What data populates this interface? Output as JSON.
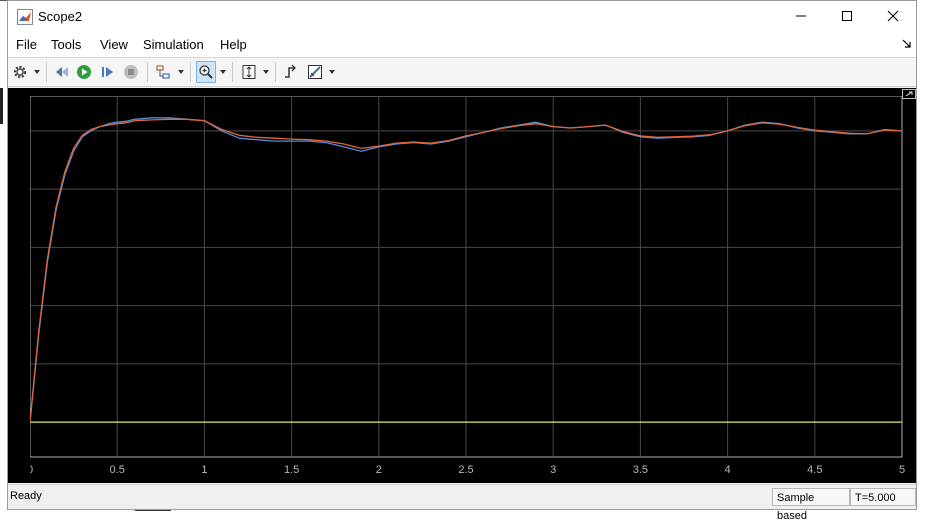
{
  "window": {
    "title": "Scope2"
  },
  "menu": {
    "items": [
      "File",
      "Tools",
      "View",
      "Simulation",
      "Help"
    ]
  },
  "toolbar": {
    "buttons": [
      "settings-icon",
      "step-back-icon",
      "run-icon",
      "step-forward-icon",
      "stop-icon",
      "signal-selector-icon",
      "zoom-in-icon",
      "scale-axes-icon",
      "triggers-icon",
      "measurements-icon"
    ]
  },
  "status": {
    "text": "Ready",
    "mode": "Sample based",
    "time": "T=5.000"
  },
  "colors": {
    "background": "#000000",
    "grid": "#4a4a4a",
    "axis_text": "#b8b8b8",
    "series_blue": "#4a8fd8",
    "series_orange": "#e0663a",
    "series_yellow": "#e8e352"
  },
  "chart_data": {
    "type": "line",
    "xlim": [
      0,
      5
    ],
    "ylim": [
      -0.12,
      1.12
    ],
    "xticks": [
      "0",
      "0.5",
      "1",
      "1.5",
      "2",
      "2.5",
      "3",
      "3.5",
      "4",
      "4.5",
      "5"
    ],
    "yticks": [
      "0",
      "0.2",
      "0.4",
      "0.6",
      "0.8",
      "1"
    ],
    "grid": true,
    "series": [
      {
        "color": "#4a8fd8",
        "x": [
          0,
          0.05,
          0.1,
          0.15,
          0.2,
          0.25,
          0.3,
          0.35,
          0.4,
          0.45,
          0.5,
          0.55,
          0.6,
          0.7,
          0.8,
          0.9,
          1.0,
          1.1,
          1.2,
          1.3,
          1.4,
          1.5,
          1.6,
          1.7,
          1.8,
          1.9,
          2.0,
          2.1,
          2.2,
          2.3,
          2.4,
          2.5,
          2.6,
          2.7,
          2.8,
          2.9,
          3.0,
          3.1,
          3.2,
          3.3,
          3.4,
          3.5,
          3.6,
          3.7,
          3.8,
          3.9,
          4.0,
          4.1,
          4.2,
          4.3,
          4.4,
          4.5,
          4.6,
          4.7,
          4.8,
          4.9,
          5.0
        ],
        "y": [
          0,
          0.3,
          0.55,
          0.73,
          0.85,
          0.93,
          0.98,
          1.0,
          1.015,
          1.025,
          1.03,
          1.033,
          1.04,
          1.045,
          1.045,
          1.04,
          1.035,
          1.0,
          0.975,
          0.97,
          0.965,
          0.965,
          0.965,
          0.96,
          0.945,
          0.93,
          0.945,
          0.955,
          0.96,
          0.955,
          0.965,
          0.98,
          0.995,
          1.01,
          1.02,
          1.03,
          1.015,
          1.01,
          1.015,
          1.02,
          0.995,
          0.98,
          0.975,
          0.978,
          0.98,
          0.985,
          1.0,
          1.02,
          1.03,
          1.025,
          1.01,
          1.0,
          0.995,
          0.99,
          0.99,
          1.005,
          1.0
        ]
      },
      {
        "color": "#e0663a",
        "x": [
          0,
          0.05,
          0.1,
          0.15,
          0.2,
          0.25,
          0.3,
          0.35,
          0.4,
          0.45,
          0.5,
          0.55,
          0.6,
          0.7,
          0.8,
          0.9,
          1.0,
          1.1,
          1.2,
          1.3,
          1.4,
          1.5,
          1.6,
          1.7,
          1.8,
          1.9,
          2.0,
          2.1,
          2.2,
          2.3,
          2.4,
          2.5,
          2.6,
          2.7,
          2.8,
          2.9,
          3.0,
          3.1,
          3.2,
          3.3,
          3.4,
          3.5,
          3.6,
          3.7,
          3.8,
          3.9,
          4.0,
          4.1,
          4.2,
          4.3,
          4.4,
          4.5,
          4.6,
          4.7,
          4.8,
          4.9,
          5.0
        ],
        "y": [
          0,
          0.31,
          0.56,
          0.74,
          0.86,
          0.94,
          0.985,
          1.005,
          1.015,
          1.02,
          1.025,
          1.028,
          1.035,
          1.038,
          1.04,
          1.04,
          1.035,
          1.005,
          0.985,
          0.978,
          0.975,
          0.972,
          0.97,
          0.965,
          0.955,
          0.94,
          0.948,
          0.958,
          0.962,
          0.958,
          0.967,
          0.983,
          0.995,
          1.008,
          1.018,
          1.025,
          1.015,
          1.01,
          1.015,
          1.02,
          0.998,
          0.983,
          0.978,
          0.98,
          0.982,
          0.987,
          1.0,
          1.018,
          1.028,
          1.023,
          1.012,
          1.003,
          0.997,
          0.992,
          0.99,
          1.003,
          1.0
        ]
      },
      {
        "color": "#e8e352",
        "x": [
          0,
          5
        ],
        "y": [
          0,
          0
        ]
      }
    ]
  }
}
